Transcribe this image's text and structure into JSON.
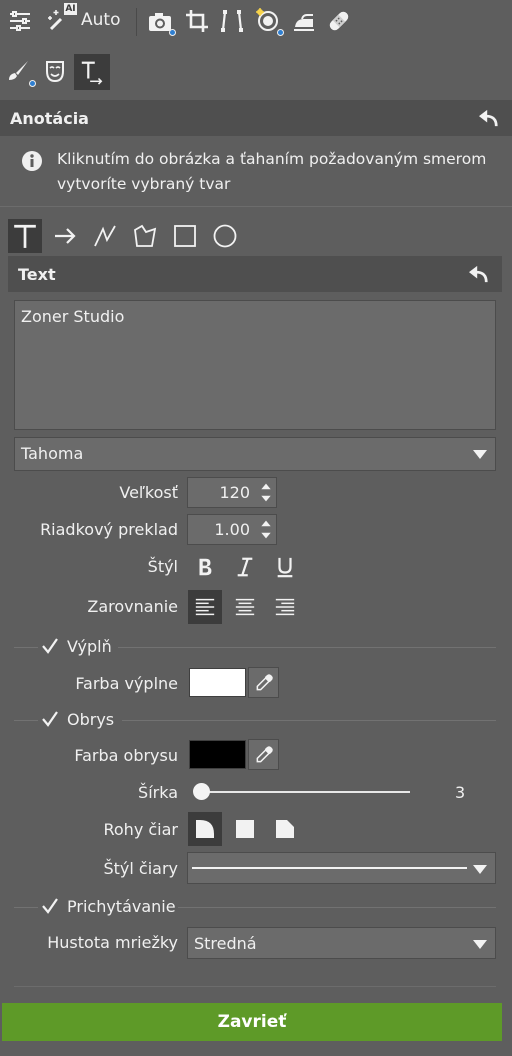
{
  "toolbar": {
    "auto_label": "Auto",
    "ai_badge": "AI",
    "icons": [
      "settings-sliders-icon",
      "magic-wand-icon",
      "camera-icon",
      "crop-icon",
      "perspective-icon",
      "healing-icon",
      "iron-icon",
      "bandage-icon"
    ]
  },
  "subtoolbar": {
    "icons": [
      "brush-icon",
      "mask-icon",
      "text-tool-icon"
    ]
  },
  "annotation": {
    "title": "Anotácia",
    "info_text": "Kliknutím do obrázka a ťahaním požadovaným smerom vytvoríte vybraný tvar"
  },
  "shape_tools": [
    "text-shape",
    "arrow-shape",
    "polyline-shape",
    "polygon-shape",
    "rectangle-shape",
    "ellipse-shape"
  ],
  "text_section": {
    "title": "Text",
    "text_value": "Zoner Studio",
    "font_value": "Tahoma",
    "size_label": "Veľkosť",
    "size_value": "120",
    "line_spacing_label": "Riadkový preklad",
    "line_spacing_value": "1.00",
    "style_label": "Štýl",
    "align_label": "Zarovnanie"
  },
  "fill": {
    "checkbox_label": "Výplň",
    "checked": true,
    "color_label": "Farba výplne",
    "color": "#ffffff"
  },
  "outline": {
    "checkbox_label": "Obrys",
    "checked": true,
    "color_label": "Farba obrysu",
    "color": "#000000",
    "width_label": "Šírka",
    "width_value": "3",
    "corners_label": "Rohy čiar",
    "line_style_label": "Štýl čiary"
  },
  "snapping": {
    "checkbox_label": "Prichytávanie",
    "checked": true,
    "grid_density_label": "Hustota mriežky",
    "grid_density_value": "Stredná"
  },
  "close_button": {
    "label": "Zavrieť",
    "color": "#5e9a28"
  }
}
